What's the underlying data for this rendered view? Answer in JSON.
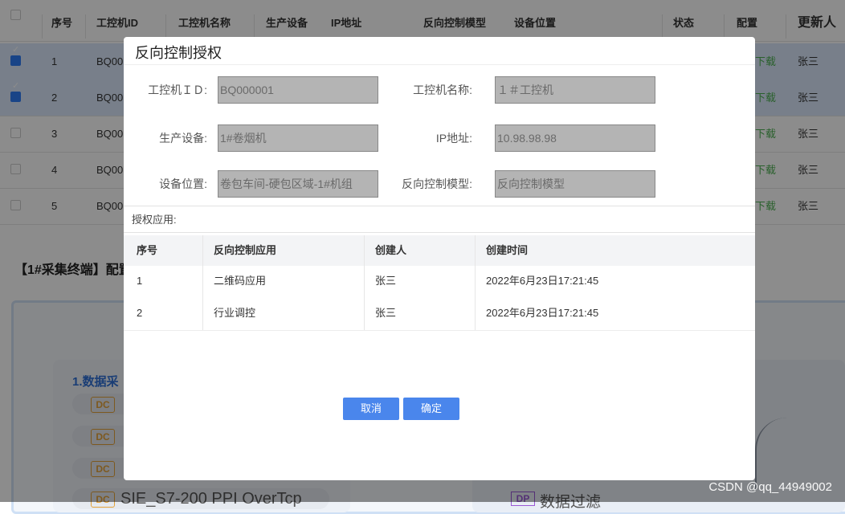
{
  "background_table": {
    "headers": [
      "序号",
      "工控机ID",
      "工控机名称",
      "生产设备",
      "IP地址",
      "反向控制模型",
      "设备位置",
      "状态",
      "配置",
      "更新人"
    ],
    "rows": [
      {
        "no": "1",
        "id": "BQ00",
        "config": "下载",
        "updater": "张三",
        "checked": true
      },
      {
        "no": "2",
        "id": "BQ00",
        "config": "下载",
        "updater": "张三",
        "checked": true
      },
      {
        "no": "3",
        "id": "BQ00",
        "config": "下载",
        "updater": "张三",
        "checked": false
      },
      {
        "no": "4",
        "id": "BQ00",
        "config": "下载",
        "updater": "张三",
        "checked": false
      },
      {
        "no": "5",
        "id": "BQ00",
        "config": "下载",
        "updater": "张三",
        "checked": false
      }
    ],
    "section_title": "【1#采集终端】配置",
    "flow_title": "1.数据采",
    "dc_tag": "DC",
    "plc_label": "SIE_S7-200 PPI OverTcp",
    "dp_tag": "DP",
    "dp_label": "数据过滤"
  },
  "watermark": "CSDN @qq_44949002",
  "modal": {
    "title": "反向控制授权",
    "fields": {
      "ipc_id": {
        "label": "工控机ＩＤ:",
        "value": "BQ000001"
      },
      "ipc_name": {
        "label": "工控机名称:",
        "value": "１＃工控机"
      },
      "device": {
        "label": "生产设备:",
        "value": "1#卷烟机"
      },
      "ip": {
        "label": "IP地址:",
        "value": "10.98.98.98"
      },
      "location": {
        "label": "设备位置:",
        "value": "卷包车间-硬包区域-1#机组"
      },
      "model": {
        "label": "反向控制模型:",
        "value": "反向控制模型"
      }
    },
    "auth_label": "授权应用:",
    "grid": {
      "headers": [
        "序号",
        "反向控制应用",
        "创建人",
        "创建时间"
      ],
      "rows": [
        {
          "no": "1",
          "app": "二维码应用",
          "creator": "张三",
          "time": "2022年6月23日17:21:45"
        },
        {
          "no": "2",
          "app": "行业调控",
          "creator": "张三",
          "time": "2022年6月23日17:21:45"
        }
      ]
    },
    "cancel_label": "取消",
    "confirm_label": "确定"
  }
}
